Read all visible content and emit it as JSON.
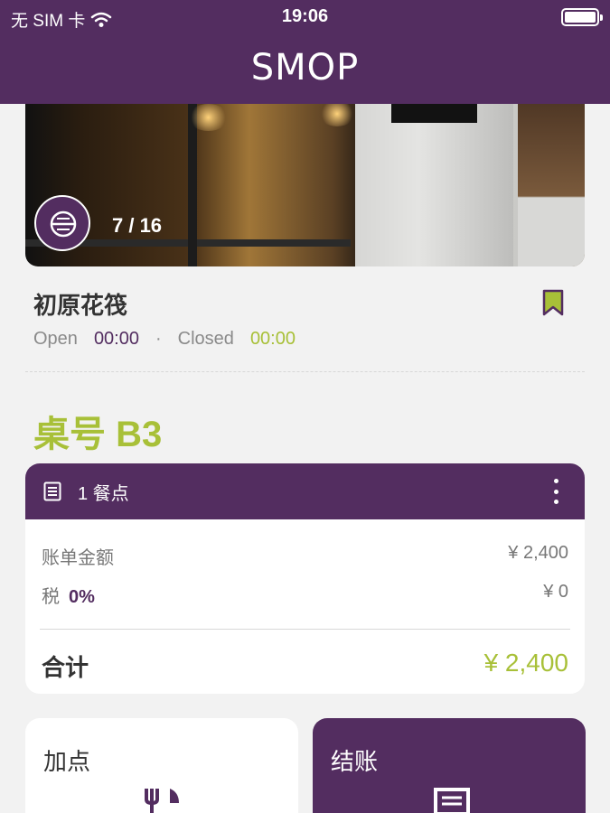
{
  "status_bar": {
    "carrier": "无 SIM 卡",
    "time": "19:06"
  },
  "header": {
    "logo": "SMOP"
  },
  "gallery": {
    "counter": "7 / 16"
  },
  "store": {
    "name": "初原花筏",
    "open_label": "Open",
    "open_time": "00:00",
    "separator": "·",
    "closed_label": "Closed",
    "closed_time": "00:00"
  },
  "table": {
    "label": "桌号 B3"
  },
  "bill": {
    "header_label": "1 餐点",
    "amount_label": "账单金额",
    "amount_value": "¥ 2,400",
    "tax_label": "税",
    "tax_rate": "0%",
    "tax_value": "¥ 0",
    "total_label": "合计",
    "total_value": "¥ 2,400"
  },
  "actions": {
    "add_label": "加点",
    "checkout_label": "结账"
  },
  "colors": {
    "brand": "#532d60",
    "accent": "#a8c038"
  }
}
